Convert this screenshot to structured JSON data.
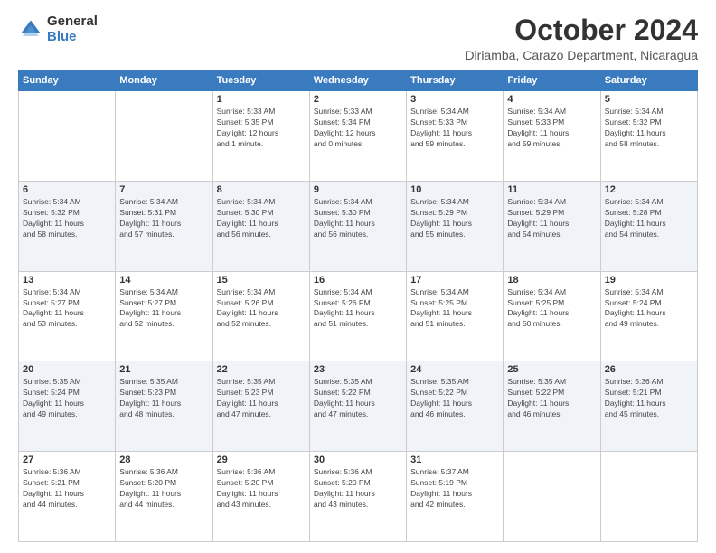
{
  "logo": {
    "general": "General",
    "blue": "Blue"
  },
  "title": "October 2024",
  "location": "Diriamba, Carazo Department, Nicaragua",
  "weekdays": [
    "Sunday",
    "Monday",
    "Tuesday",
    "Wednesday",
    "Thursday",
    "Friday",
    "Saturday"
  ],
  "weeks": [
    [
      {
        "day": "",
        "info": ""
      },
      {
        "day": "",
        "info": ""
      },
      {
        "day": "1",
        "info": "Sunrise: 5:33 AM\nSunset: 5:35 PM\nDaylight: 12 hours\nand 1 minute."
      },
      {
        "day": "2",
        "info": "Sunrise: 5:33 AM\nSunset: 5:34 PM\nDaylight: 12 hours\nand 0 minutes."
      },
      {
        "day": "3",
        "info": "Sunrise: 5:34 AM\nSunset: 5:33 PM\nDaylight: 11 hours\nand 59 minutes."
      },
      {
        "day": "4",
        "info": "Sunrise: 5:34 AM\nSunset: 5:33 PM\nDaylight: 11 hours\nand 59 minutes."
      },
      {
        "day": "5",
        "info": "Sunrise: 5:34 AM\nSunset: 5:32 PM\nDaylight: 11 hours\nand 58 minutes."
      }
    ],
    [
      {
        "day": "6",
        "info": "Sunrise: 5:34 AM\nSunset: 5:32 PM\nDaylight: 11 hours\nand 58 minutes."
      },
      {
        "day": "7",
        "info": "Sunrise: 5:34 AM\nSunset: 5:31 PM\nDaylight: 11 hours\nand 57 minutes."
      },
      {
        "day": "8",
        "info": "Sunrise: 5:34 AM\nSunset: 5:30 PM\nDaylight: 11 hours\nand 56 minutes."
      },
      {
        "day": "9",
        "info": "Sunrise: 5:34 AM\nSunset: 5:30 PM\nDaylight: 11 hours\nand 56 minutes."
      },
      {
        "day": "10",
        "info": "Sunrise: 5:34 AM\nSunset: 5:29 PM\nDaylight: 11 hours\nand 55 minutes."
      },
      {
        "day": "11",
        "info": "Sunrise: 5:34 AM\nSunset: 5:29 PM\nDaylight: 11 hours\nand 54 minutes."
      },
      {
        "day": "12",
        "info": "Sunrise: 5:34 AM\nSunset: 5:28 PM\nDaylight: 11 hours\nand 54 minutes."
      }
    ],
    [
      {
        "day": "13",
        "info": "Sunrise: 5:34 AM\nSunset: 5:27 PM\nDaylight: 11 hours\nand 53 minutes."
      },
      {
        "day": "14",
        "info": "Sunrise: 5:34 AM\nSunset: 5:27 PM\nDaylight: 11 hours\nand 52 minutes."
      },
      {
        "day": "15",
        "info": "Sunrise: 5:34 AM\nSunset: 5:26 PM\nDaylight: 11 hours\nand 52 minutes."
      },
      {
        "day": "16",
        "info": "Sunrise: 5:34 AM\nSunset: 5:26 PM\nDaylight: 11 hours\nand 51 minutes."
      },
      {
        "day": "17",
        "info": "Sunrise: 5:34 AM\nSunset: 5:25 PM\nDaylight: 11 hours\nand 51 minutes."
      },
      {
        "day": "18",
        "info": "Sunrise: 5:34 AM\nSunset: 5:25 PM\nDaylight: 11 hours\nand 50 minutes."
      },
      {
        "day": "19",
        "info": "Sunrise: 5:34 AM\nSunset: 5:24 PM\nDaylight: 11 hours\nand 49 minutes."
      }
    ],
    [
      {
        "day": "20",
        "info": "Sunrise: 5:35 AM\nSunset: 5:24 PM\nDaylight: 11 hours\nand 49 minutes."
      },
      {
        "day": "21",
        "info": "Sunrise: 5:35 AM\nSunset: 5:23 PM\nDaylight: 11 hours\nand 48 minutes."
      },
      {
        "day": "22",
        "info": "Sunrise: 5:35 AM\nSunset: 5:23 PM\nDaylight: 11 hours\nand 47 minutes."
      },
      {
        "day": "23",
        "info": "Sunrise: 5:35 AM\nSunset: 5:22 PM\nDaylight: 11 hours\nand 47 minutes."
      },
      {
        "day": "24",
        "info": "Sunrise: 5:35 AM\nSunset: 5:22 PM\nDaylight: 11 hours\nand 46 minutes."
      },
      {
        "day": "25",
        "info": "Sunrise: 5:35 AM\nSunset: 5:22 PM\nDaylight: 11 hours\nand 46 minutes."
      },
      {
        "day": "26",
        "info": "Sunrise: 5:36 AM\nSunset: 5:21 PM\nDaylight: 11 hours\nand 45 minutes."
      }
    ],
    [
      {
        "day": "27",
        "info": "Sunrise: 5:36 AM\nSunset: 5:21 PM\nDaylight: 11 hours\nand 44 minutes."
      },
      {
        "day": "28",
        "info": "Sunrise: 5:36 AM\nSunset: 5:20 PM\nDaylight: 11 hours\nand 44 minutes."
      },
      {
        "day": "29",
        "info": "Sunrise: 5:36 AM\nSunset: 5:20 PM\nDaylight: 11 hours\nand 43 minutes."
      },
      {
        "day": "30",
        "info": "Sunrise: 5:36 AM\nSunset: 5:20 PM\nDaylight: 11 hours\nand 43 minutes."
      },
      {
        "day": "31",
        "info": "Sunrise: 5:37 AM\nSunset: 5:19 PM\nDaylight: 11 hours\nand 42 minutes."
      },
      {
        "day": "",
        "info": ""
      },
      {
        "day": "",
        "info": ""
      }
    ]
  ]
}
